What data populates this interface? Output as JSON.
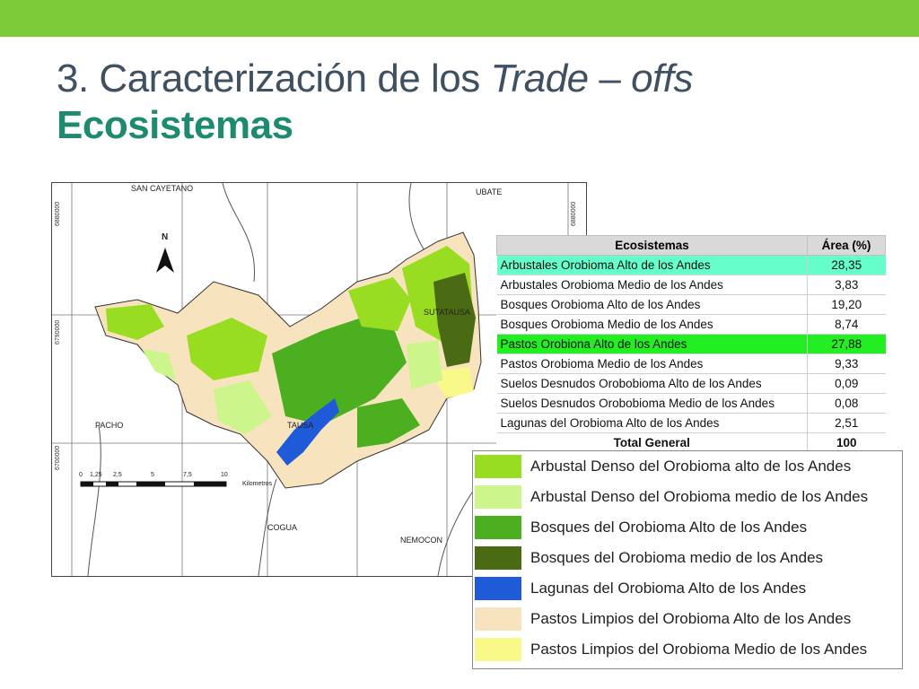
{
  "slide": {
    "title_prefix": "3. Caracterización de los ",
    "title_italic1": "Trade",
    "title_dash": " – ",
    "title_italic2": "offs",
    "subtitle": "Ecosistemas"
  },
  "map": {
    "places": {
      "san_cayetano": "SAN CAYETANO",
      "ubate": "UBATE",
      "sutatausa": "SUTATAUSA",
      "tausa": "TAUSA",
      "pacho": "PACHO",
      "cogua": "COGUA",
      "nemocon": "NEMOCON"
    },
    "north": "N",
    "scale_ticks": [
      "0",
      "1,25",
      "2,5",
      "5",
      "7,5",
      "10"
    ],
    "scale_unit": "Kilometros",
    "coords": {
      "left_top": "6880000",
      "left_mid": "6790000",
      "left_low": "6700000",
      "right_top": "6880000"
    }
  },
  "table": {
    "headers": [
      "Ecosistemas",
      "Área (%)"
    ],
    "rows": [
      {
        "name": "Arbustales Orobioma Alto de los Andes",
        "area": "28,35"
      },
      {
        "name": "Arbustales Orobioma Medio de los Andes",
        "area": "3,83"
      },
      {
        "name": "Bosques Orobioma Alto de los Andes",
        "area": "19,20"
      },
      {
        "name": "Bosques Orobioma Medio de los Andes",
        "area": "8,74"
      },
      {
        "name": "Pastos Orobiona Alto de los Andes",
        "area": "27,88"
      },
      {
        "name": "Pastos Orobioma Medio de los Andes",
        "area": "9,33"
      },
      {
        "name": "Suelos Desnudos Orobobioma Alto de los Andes",
        "area": "0,09"
      },
      {
        "name": "Suelos Desnudos Orobobioma Medio de los Andes",
        "area": "0,08"
      },
      {
        "name": "Lagunas del Orobioma Alto de los Andes",
        "area": "2,51"
      }
    ],
    "total_label": "Total General",
    "total_value": "100",
    "highlight_colors": {
      "cyan": "#66ffcc",
      "green": "#22ee22"
    }
  },
  "legend": {
    "items": [
      {
        "label": "Arbustal Denso del Orobioma alto de los Andes",
        "color": "#99dd22"
      },
      {
        "label": "Arbustal Denso del Orobioma medio de los Andes",
        "color": "#ccf58c"
      },
      {
        "label": "Bosques del Orobioma Alto de los Andes",
        "color": "#4caf20"
      },
      {
        "label": "Bosques del Orobioma medio de los Andes",
        "color": "#4a6b14"
      },
      {
        "label": "Lagunas del Orobioma Alto de los Andes",
        "color": "#1f5ad8"
      },
      {
        "label": "Pastos Limpios del Orobioma Alto de los Andes",
        "color": "#f7e3bd"
      },
      {
        "label": "Pastos Limpios del Orobioma Medio de los Andes",
        "color": "#f9f98a"
      }
    ]
  },
  "theme": {
    "accent_bar": "#7ccc3a",
    "title_color": "#3f5060",
    "subtitle_color": "#1e8a70"
  }
}
